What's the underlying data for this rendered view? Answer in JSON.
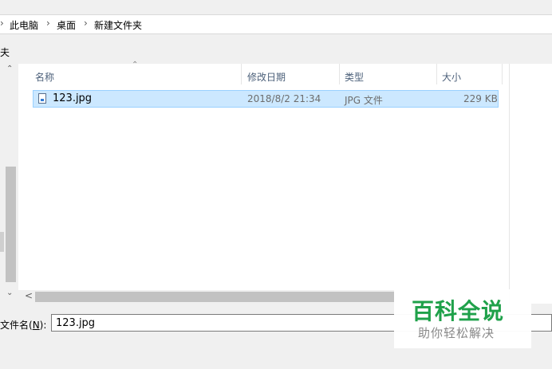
{
  "breadcrumb": {
    "items": [
      "此电脑",
      "桌面",
      "新建文件夹"
    ]
  },
  "nav_pane": {
    "truncated_label": "夫"
  },
  "columns": {
    "name": "名称",
    "modified": "修改日期",
    "type": "类型",
    "size": "大小"
  },
  "files": [
    {
      "name": "123.jpg",
      "modified": "2018/8/2 21:34",
      "type": "JPG 文件",
      "size": "229 KB"
    }
  ],
  "filename_field": {
    "label_prefix": "文件名(",
    "label_mnemonic": "N",
    "label_suffix": "):",
    "value": "123.jpg"
  },
  "watermark": {
    "title": "百科全说",
    "subtitle": "助你轻松解决"
  },
  "colors": {
    "selection_bg": "#cce8ff",
    "selection_border": "#99d1ff",
    "watermark_green": "#1fa14a"
  }
}
